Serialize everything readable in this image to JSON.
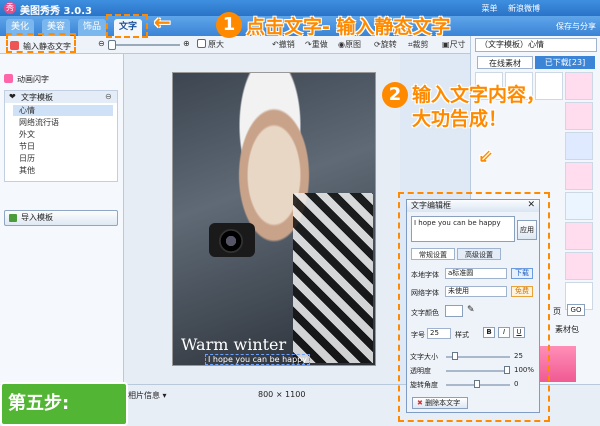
{
  "app": {
    "title": "美图秀秀 3.0.3",
    "logo_glyph": "秀"
  },
  "menu": [
    "菜单",
    "新浪微博",
    "最小化",
    "关闭"
  ],
  "tabs": [
    {
      "label": "美化",
      "active": false
    },
    {
      "label": "美容",
      "active": false
    },
    {
      "label": "饰品",
      "active": false
    },
    {
      "label": "文字",
      "active": true
    }
  ],
  "share_label": "保存与分享",
  "toolbar": {
    "original_size": "原大",
    "undo": "撤销",
    "redo": "重做",
    "original": "原图",
    "rotate": "旋转",
    "crop": "裁剪",
    "size": "尺寸"
  },
  "left": {
    "static_text": "输入静态文字",
    "animated_text": "动画闪字",
    "template_header": "文字模板",
    "subitems": [
      "心情",
      "网络流行语",
      "外文",
      "节日",
      "日历",
      "其他"
    ],
    "import_button": "导入模板"
  },
  "canvas": {
    "watermark": "Warm winter",
    "overlay_text": "I hope you can be happy"
  },
  "right": {
    "dropdown": "（文字模板）心情",
    "tab_online": "在线素材",
    "tab_downloaded": "已下载[23]",
    "page_label": "页",
    "go_button": "GO",
    "material_btn": "素材包",
    "banner": "精选"
  },
  "dialog": {
    "title": "文字编辑框",
    "close": "✕",
    "textarea_value": "I hope you can be happy",
    "apply": "应用",
    "tab_basic": "常规设置",
    "tab_advanced": "高级设置",
    "local_font_label": "本地字体",
    "local_font_value": "a标准圆",
    "download_badge": "下载",
    "web_font_label": "网络字体",
    "web_font_value": "未使用",
    "free_badge": "免费",
    "color_label": "文字颜色",
    "size_label": "字号",
    "size_value": "25",
    "style_label": "样式",
    "bold": "B",
    "italic": "I",
    "underline": "U",
    "text_size_label": "文字大小",
    "text_size_value": "25",
    "opacity_label": "透明度",
    "opacity_value": "100%",
    "opacity_fraction": 1.0,
    "rotate_label": "旋转角度",
    "rotate_value": "0",
    "delete_button": "删除本文字"
  },
  "status": {
    "info": "相片信息 ▾",
    "size": "800 × 1100"
  },
  "annotations": {
    "step_badge": "第五步:",
    "step1_num": "1",
    "step1_text": "点击文字- 输入静态文字",
    "step2_num": "2",
    "step2_line1": "输入文字内容，",
    "step2_line2": "大功告成！"
  },
  "colors": {
    "accent_orange": "#ff8a00",
    "step_green": "#53b534",
    "title_blue": "#2a73c8"
  }
}
